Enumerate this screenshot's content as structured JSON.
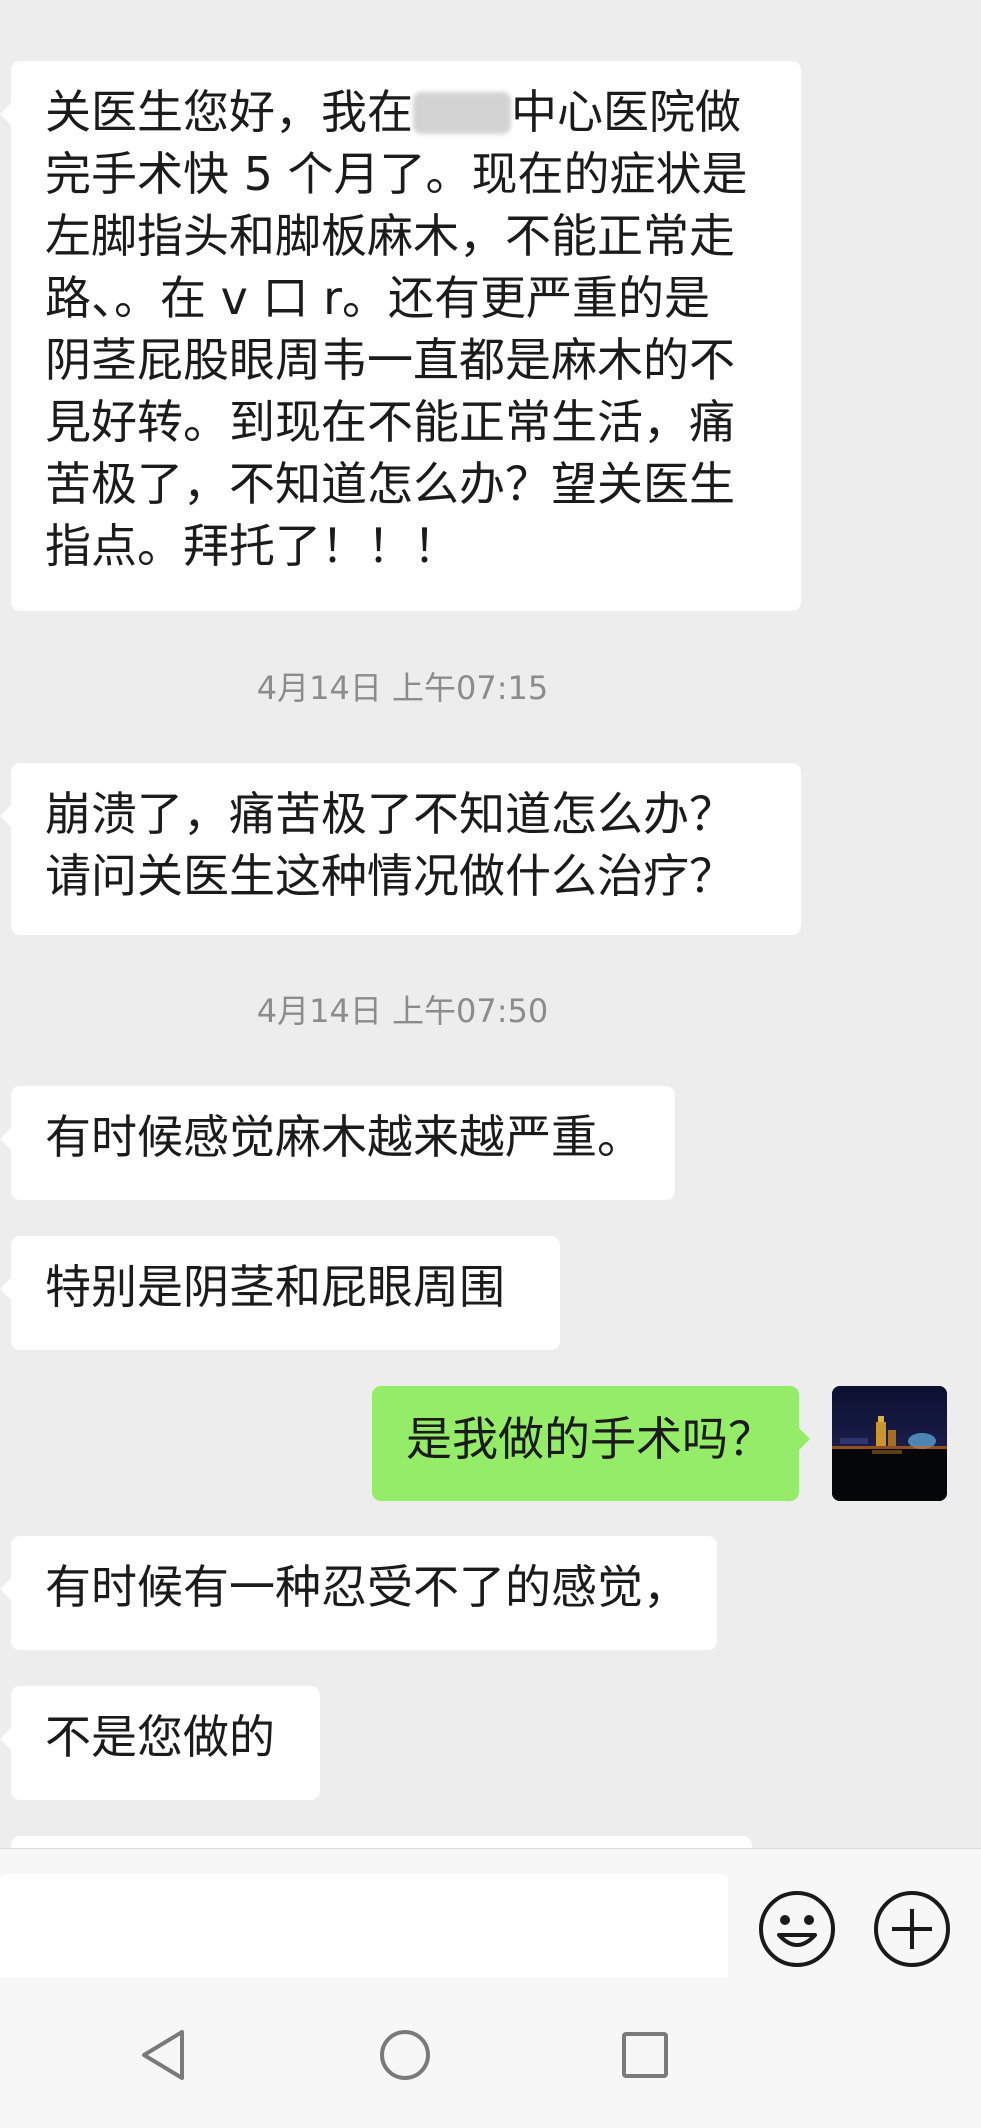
{
  "chat": {
    "messages": [
      {
        "id": "m1",
        "side": "in",
        "lines": [
          "关医生您好，我在",
          "中心医院做",
          "完手术快 5 个月了。现在的症状是",
          "左脚指头和脚板麻木，不能正常走",
          "路、。在 v 口 r。还有更严重的是",
          "阴茎屁股眼周韦一直都是麻木的不",
          "見好转。到现在不能正常生活，痛",
          "苦极了，不知道怎么办？望关医生",
          "指点。拜托了！！！"
        ]
      },
      {
        "id": "t1",
        "type": "timestamp",
        "text": "4月14日 上午07:15"
      },
      {
        "id": "m2",
        "side": "in",
        "lines": [
          "崩溃了，痛苦极了不知道怎么办？",
          "请问关医生这种情况做什么治疗？"
        ]
      },
      {
        "id": "t2",
        "type": "timestamp",
        "text": "4月14日 上午07:50"
      },
      {
        "id": "m3",
        "side": "in",
        "lines": [
          "有时候感觉麻木越来越严重。"
        ]
      },
      {
        "id": "m4",
        "side": "in",
        "lines": [
          "特别是阴茎和屁眼周围"
        ]
      },
      {
        "id": "m5",
        "side": "out",
        "lines": [
          "是我做的手术吗？"
        ]
      },
      {
        "id": "m6",
        "side": "in",
        "lines": [
          "有时候有一种忍受不了的感觉，"
        ]
      },
      {
        "id": "m7",
        "side": "in",
        "lines": [
          "不是您做的"
        ]
      }
    ],
    "avatar_icon": "night-cityscape-avatar"
  },
  "input_bar": {
    "placeholder": "",
    "emoji_icon": "emoji-icon",
    "plus_icon": "plus-icon"
  },
  "navbar": {
    "back_icon": "back-triangle-icon",
    "home_icon": "home-circle-icon",
    "recents_icon": "recents-square-icon"
  },
  "colors": {
    "background": "#ededed",
    "incoming_bubble": "#ffffff",
    "outgoing_bubble": "#95ec69",
    "timestamp_text": "#8c8c8c"
  }
}
